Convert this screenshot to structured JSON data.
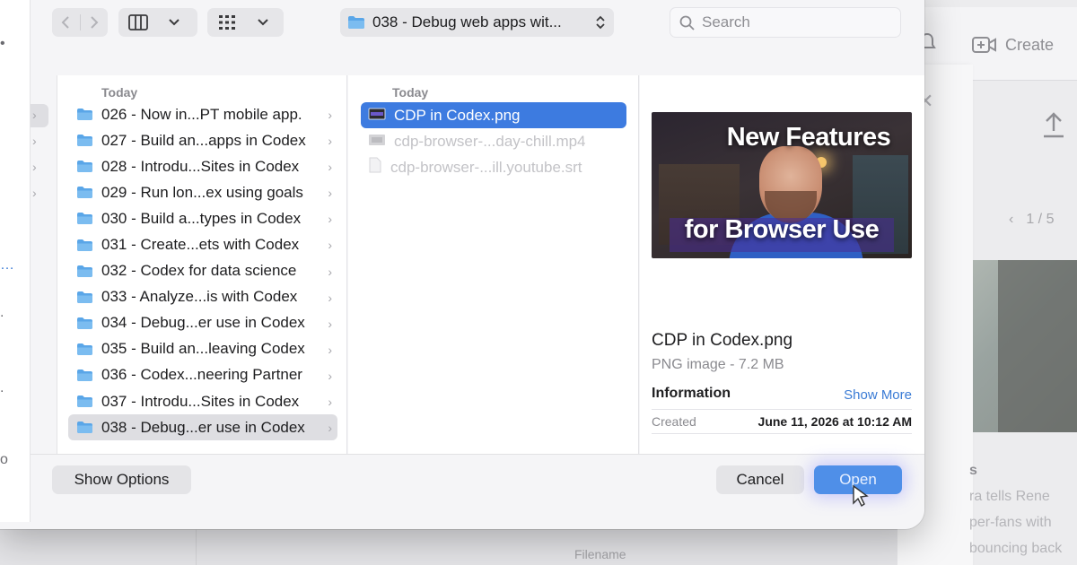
{
  "background": {
    "create_label": "Create",
    "pager": "1 / 5",
    "description_lines": [
      "s",
      "ra tells Rene",
      "per-fans with",
      "bouncing back"
    ],
    "filename_label": "Filename"
  },
  "sidebar": {
    "glyphs": [
      "•",
      "…",
      ".",
      ".",
      "o"
    ]
  },
  "toolbar": {
    "back_icon": "chevron-left-icon",
    "forward_icon": "chevron-right-icon",
    "view_icon": "column-view-icon",
    "group_icon": "grid-group-icon",
    "location": "038 - Debug web apps wit...",
    "search_placeholder": "Search"
  },
  "columns": {
    "folders_header": "Today",
    "folders": [
      "026 - Now in...PT mobile app.",
      "027 - Build an...apps in Codex",
      "028 - Introdu...Sites in Codex",
      "029 - Run lon...ex using goals",
      "030 - Build a...types in Codex",
      "031 - Create...ets with Codex",
      "032 - Codex for data science",
      "033 - Analyze...is with Codex",
      "034 - Debug...er use in Codex",
      "035 - Build an...leaving Codex",
      "036 - Codex...neering Partner",
      "037 - Introdu...Sites in Codex",
      "038 - Debug...er use in Codex"
    ],
    "selected_folder_index": 12,
    "files_header": "Today",
    "files": [
      {
        "name": "CDP in Codex.png",
        "selected": true,
        "enabled": true
      },
      {
        "name": "cdp-browser-...day-chill.mp4",
        "selected": false,
        "enabled": false
      },
      {
        "name": "cdp-browser-...ill.youtube.srt",
        "selected": false,
        "enabled": false
      }
    ]
  },
  "preview": {
    "thumbnail_line1": "New Features",
    "thumbnail_line2": "for Browser Use",
    "name": "CDP in Codex.png",
    "kind": "PNG image - 7.2 MB",
    "info_label": "Information",
    "show_more": "Show More",
    "created_label": "Created",
    "created_value": "June 11, 2026 at 10:12 AM"
  },
  "buttons": {
    "show_options": "Show Options",
    "cancel": "Cancel",
    "open": "Open"
  },
  "colors": {
    "accent": "#3d7be0",
    "folder": "#5aa6e8",
    "link": "#3a7bd5"
  }
}
